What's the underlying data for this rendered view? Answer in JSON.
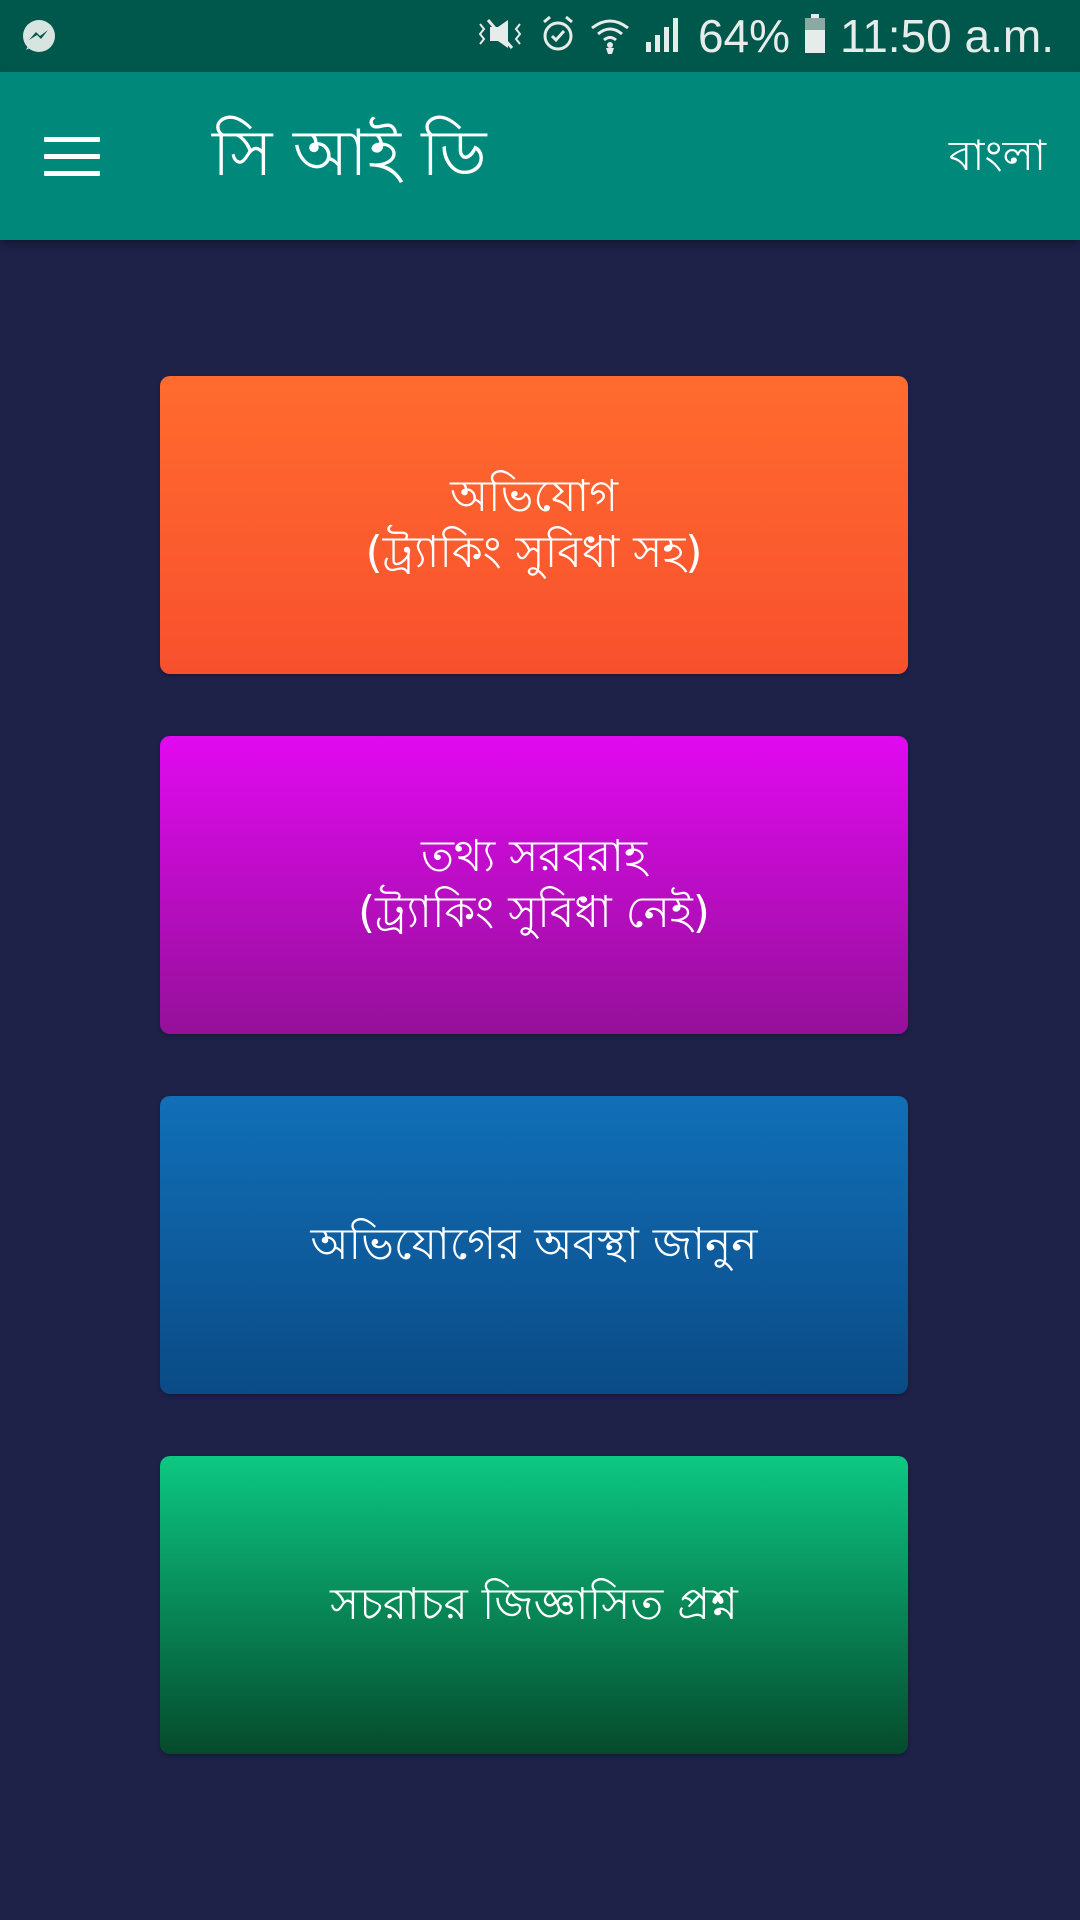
{
  "status_bar": {
    "battery": "64%",
    "time": "11:50 a.m.",
    "icons": [
      "messenger-icon",
      "mute-icon",
      "alarm-icon",
      "wifi-icon",
      "signal-icon",
      "battery-icon"
    ]
  },
  "app_bar": {
    "title": "সি আই ডি",
    "language_label": "বাংলা",
    "menu_icon": "hamburger-menu-icon"
  },
  "tiles": [
    {
      "line1": "অভিযোগ",
      "line2": "(ট্র্যাকিং সুবিধা সহ)",
      "color_top": "#ff6b2e",
      "color_bottom": "#f8502e"
    },
    {
      "line1": "তথ্য সরবরাহ",
      "line2": "(ট্র্যাকিং সুবিধা নেই)",
      "color_top": "#e10af0",
      "color_bottom": "#951099"
    },
    {
      "line1": "অভিযোগের অবস্থা জানুন",
      "color_top": "#116fb8",
      "color_bottom": "#0a4b85"
    },
    {
      "line1": "সচরাচর জিজ্ঞাসিত প্রশ্ন",
      "color_top": "#0cc882",
      "color_bottom": "#054a2c"
    }
  ],
  "colors": {
    "background": "#1e2249",
    "status_bar": "#00574b",
    "app_bar": "#00897b"
  }
}
